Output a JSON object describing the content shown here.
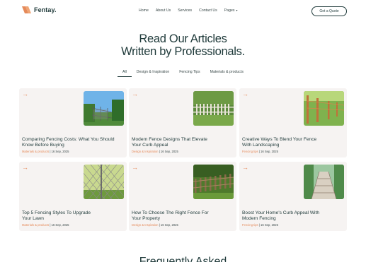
{
  "brand": {
    "name": "Fentay.",
    "accent": "#e58a5a",
    "dark": "#1f3a3a"
  },
  "nav": {
    "items": [
      "Home",
      "About Us",
      "Services",
      "Contact Us",
      "Pages"
    ],
    "cta": "Get a Quote"
  },
  "hero": {
    "line1": "Read Our Articles",
    "line2": "Written by Professionals."
  },
  "tabs": [
    "All",
    "Design & Inspiration",
    "Fencing Tips",
    "Materials & products"
  ],
  "active_tab": "All",
  "articles": [
    {
      "title_l1": "Comparing Fencing Costs: What You Should",
      "title_l2": "Know Before Buying",
      "category": "Materials & products",
      "date": "16 Sep, 2025",
      "thumb": "fence-garden"
    },
    {
      "title_l1": "Modern Fence Designs That Elevate",
      "title_l2": "Your Curb Appeal",
      "category": "Design & Inspiration",
      "date": "16 Sep, 2025",
      "thumb": "picket-fence"
    },
    {
      "title_l1": "Creative Ways To Blend Your Fence",
      "title_l2": "With Landscaping",
      "category": "Fencing tips",
      "date": "16 Sep, 2025",
      "thumb": "post-fence"
    },
    {
      "title_l1": "Top 5 Fencing Styles To Upgrade",
      "title_l2": "Your Lawn",
      "category": "Materials & products",
      "date": "16 Sep, 2025",
      "thumb": "chain-link"
    },
    {
      "title_l1": "How To Choose The Right Fence For",
      "title_l2": "Your Property",
      "category": "Design & Inspiration",
      "date": "16 Sep, 2025",
      "thumb": "wood-fence"
    },
    {
      "title_l1": "Boost Your Home's Curb Appeal With",
      "title_l2": "Modern Fencing",
      "category": "Fencing tips",
      "date": "16 Sep, 2025",
      "thumb": "bridge"
    }
  ],
  "next_section": {
    "title": "Frequently Asked"
  }
}
